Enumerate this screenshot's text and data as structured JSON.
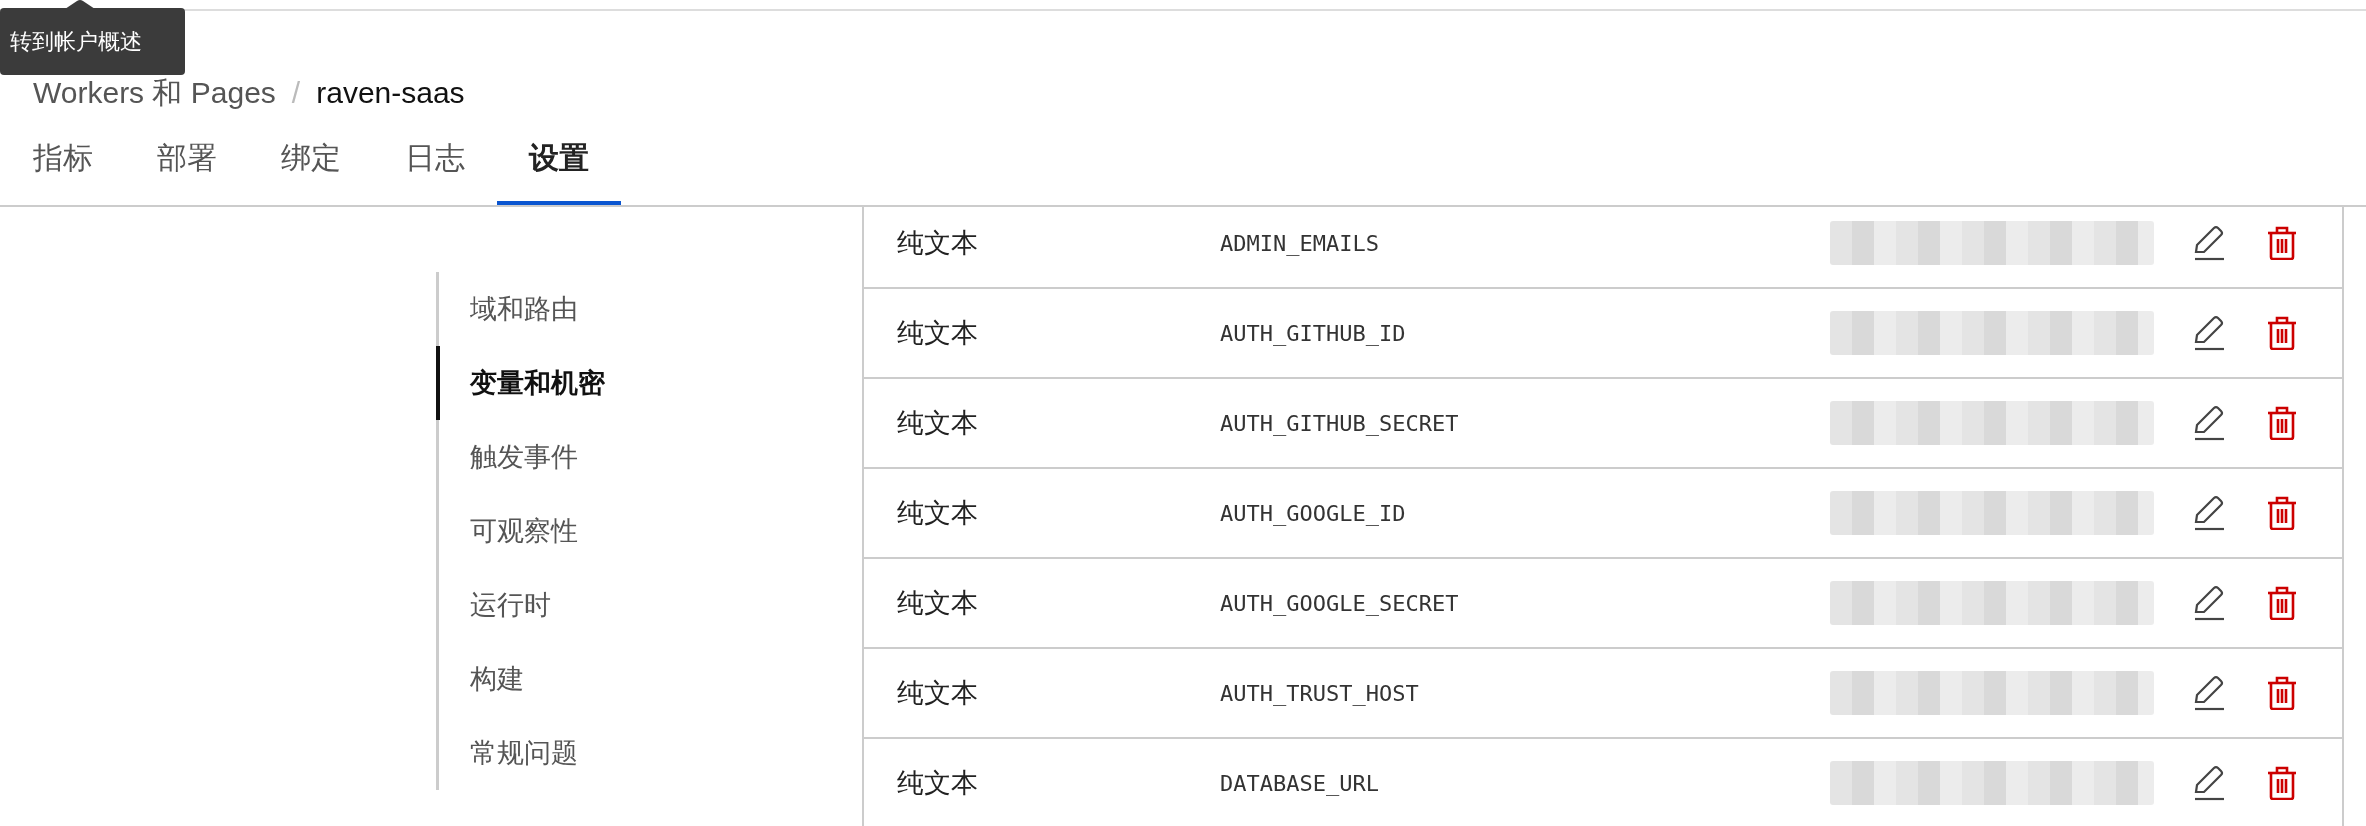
{
  "tooltip": {
    "text": "转到帐户概述"
  },
  "breadcrumb": {
    "separator": "/",
    "items": [
      {
        "label": "Workers 和 Pages"
      },
      {
        "label": "raven-saas"
      }
    ]
  },
  "tabs": [
    {
      "label": "指标",
      "selected": false
    },
    {
      "label": "部署",
      "selected": false
    },
    {
      "label": "绑定",
      "selected": false
    },
    {
      "label": "日志",
      "selected": false
    },
    {
      "label": "设置",
      "selected": true
    }
  ],
  "sidebar": {
    "items": [
      {
        "label": "域和路由",
        "selected": false
      },
      {
        "label": "变量和机密",
        "selected": true
      },
      {
        "label": "触发事件",
        "selected": false
      },
      {
        "label": "可观察性",
        "selected": false
      },
      {
        "label": "运行时",
        "selected": false
      },
      {
        "label": "构建",
        "selected": false
      },
      {
        "label": "常规问题",
        "selected": false
      }
    ]
  },
  "table": {
    "rows": [
      {
        "type": "纯文本",
        "name": "ADMIN_EMAILS"
      },
      {
        "type": "纯文本",
        "name": "AUTH_GITHUB_ID"
      },
      {
        "type": "纯文本",
        "name": "AUTH_GITHUB_SECRET"
      },
      {
        "type": "纯文本",
        "name": "AUTH_GOOGLE_ID"
      },
      {
        "type": "纯文本",
        "name": "AUTH_GOOGLE_SECRET"
      },
      {
        "type": "纯文本",
        "name": "AUTH_TRUST_HOST"
      },
      {
        "type": "纯文本",
        "name": "DATABASE_URL"
      }
    ]
  }
}
